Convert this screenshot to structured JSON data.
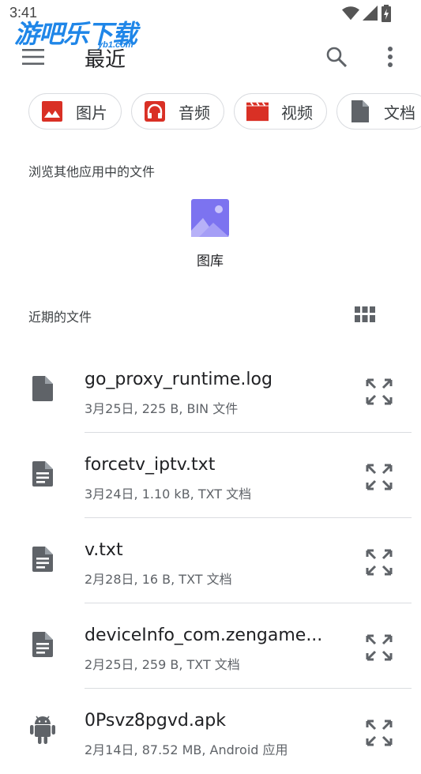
{
  "status_bar": {
    "time": "3:41"
  },
  "watermark": {
    "text": "游吧乐下载",
    "sub": "yb1.com"
  },
  "app_bar": {
    "title": "最近"
  },
  "chips": [
    {
      "label": "图片",
      "icon": "image-icon",
      "color": "#d93025"
    },
    {
      "label": "音频",
      "icon": "headphones-icon",
      "color": "#d93025"
    },
    {
      "label": "视频",
      "icon": "movie-icon",
      "color": "#d93025"
    },
    {
      "label": "文档",
      "icon": "document-icon",
      "color": "#5f6368"
    }
  ],
  "browse_section": {
    "label": "浏览其他应用中的文件",
    "apps": [
      {
        "label": "图库",
        "icon": "gallery-icon",
        "color": "#7c73f0"
      }
    ]
  },
  "recent_section": {
    "label": "近期的文件"
  },
  "files": [
    {
      "name": "go_proxy_runtime.log",
      "meta": "3月25日, 225 B, BIN 文件",
      "icon": "file-icon"
    },
    {
      "name": "forcetv_iptv.txt",
      "meta": "3月24日, 1.10 kB, TXT 文档",
      "icon": "text-file-icon"
    },
    {
      "name": "v.txt",
      "meta": "2月28日, 16 B, TXT 文档",
      "icon": "text-file-icon"
    },
    {
      "name": "deviceInfo_com.zengame....",
      "meta": "2月25日, 259 B, TXT 文档",
      "icon": "text-file-icon"
    },
    {
      "name": "0Psvz8pgvd.apk",
      "meta": "2月14日, 87.52 MB, Android 应用",
      "icon": "android-icon"
    }
  ]
}
